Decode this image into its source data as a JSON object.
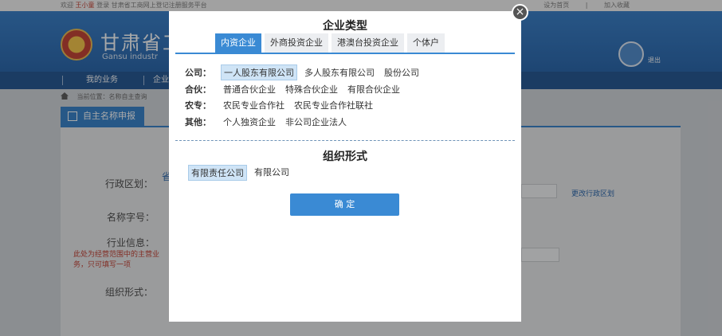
{
  "topbar": {
    "welcome": "欢迎",
    "user": "王小童",
    "login_text": "登录 甘肃省工商网上登记注册服务平台",
    "links": [
      "设为首页",
      "|",
      "加入收藏"
    ]
  },
  "header": {
    "title": "甘肃省工",
    "subtitle": "Gansu industr",
    "logout": "退出"
  },
  "nav": {
    "items": [
      "我的业务",
      "企业"
    ]
  },
  "breadcrumb": {
    "text": "当前位置：名称自主查询"
  },
  "page_tab": {
    "label": "自主名称申报"
  },
  "form": {
    "region_label": "行政区划：",
    "name_label": "名称字号：",
    "industry_label": "行业信息：",
    "industry_hint": "此处为经营范围中的主营业务，只可填写一项",
    "org_label": "组织形式：",
    "region_link": "更改行政区划",
    "fragment": "省"
  },
  "modal": {
    "title": "企业类型",
    "tabs": [
      "内资企业",
      "外商投资企业",
      "港澳台投资企业",
      "个体户"
    ],
    "active_tab": 0,
    "categories": [
      {
        "key": "公司：",
        "options": [
          "一人股东有限公司",
          "多人股东有限公司",
          "股份公司"
        ],
        "selected": 0
      },
      {
        "key": "合伙：",
        "options": [
          "普通合伙企业",
          "特殊合伙企业",
          "有限合伙企业"
        ],
        "selected": -1
      },
      {
        "key": "农专：",
        "options": [
          "农民专业合作社",
          "农民专业合作社联社"
        ],
        "selected": -1
      },
      {
        "key": "其他：",
        "options": [
          "个人独资企业",
          "非公司企业法人"
        ],
        "selected": -1
      }
    ],
    "org_title": "组织形式",
    "org_options": [
      "有限责任公司",
      "有限公司"
    ],
    "org_selected": 0,
    "confirm_label": "确 定",
    "close_icon": "×"
  }
}
